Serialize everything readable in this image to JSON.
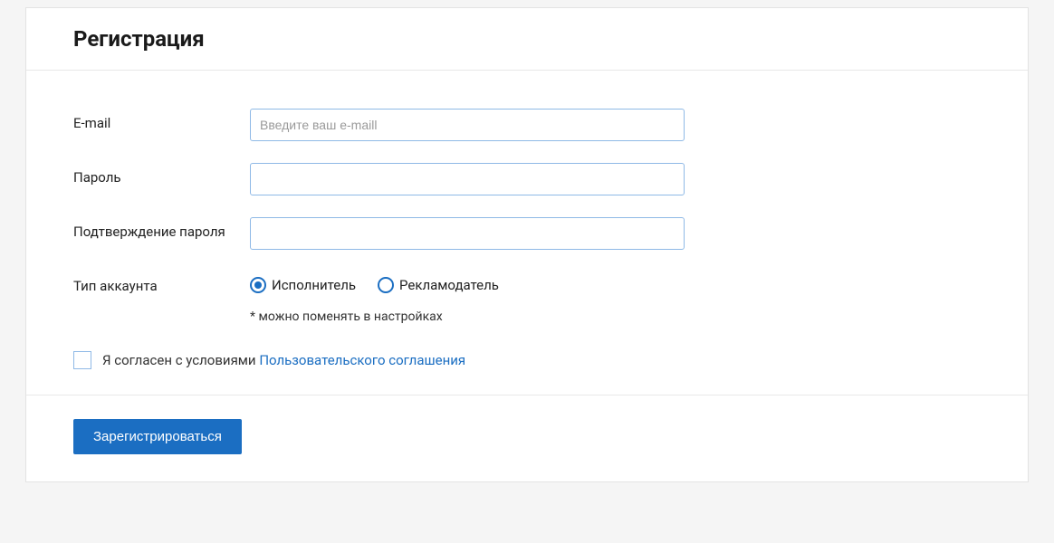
{
  "header": {
    "title": "Регистрация"
  },
  "form": {
    "email": {
      "label": "E-mail",
      "placeholder": "Введите ваш e-maill",
      "value": ""
    },
    "password": {
      "label": "Пароль",
      "value": ""
    },
    "confirm_password": {
      "label": "Подтверждение пароля",
      "value": ""
    },
    "account_type": {
      "label": "Тип аккаунта",
      "options": {
        "performer": "Исполнитель",
        "advertiser": "Рекламодатель"
      },
      "selected": "performer",
      "hint": "* можно поменять в настройках"
    },
    "agreement": {
      "text": "Я согласен с условиями ",
      "link_text": "Пользовательского соглашения",
      "checked": false
    },
    "submit_label": "Зарегистрироваться"
  }
}
